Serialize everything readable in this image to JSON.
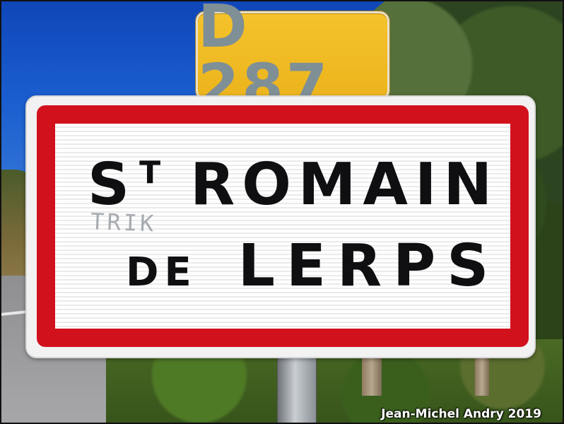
{
  "route_plate": {
    "text": "D 287"
  },
  "sign": {
    "saint": "S",
    "saint_suffix": "T",
    "line1_rest": "ROMAIN",
    "line2_de": "DE",
    "line2_name": "LERPS"
  },
  "graffiti": {
    "text": "TRIK"
  },
  "credit": {
    "text": "Jean-Michel Andry 2019"
  },
  "colors": {
    "sign_border": "#d1121d",
    "route_plate": "#ecb41d",
    "route_text": "#7f8f96",
    "lettering": "#0f0f12"
  }
}
